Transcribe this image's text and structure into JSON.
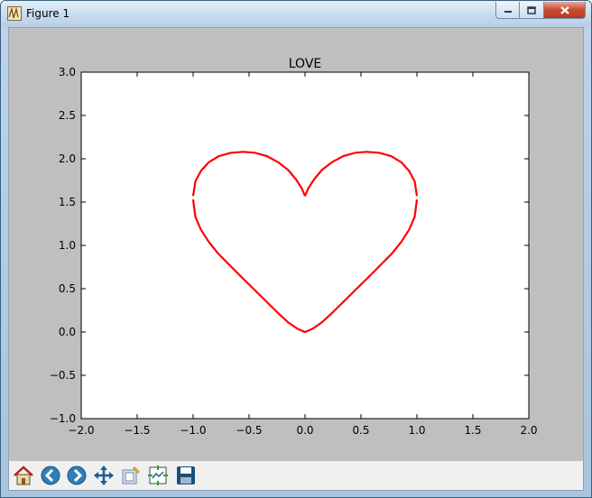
{
  "window": {
    "title": "Figure 1"
  },
  "toolbar": {
    "buttons": [
      {
        "name": "home-button",
        "icon": "home-icon"
      },
      {
        "name": "back-button",
        "icon": "back-arrow-icon"
      },
      {
        "name": "forward-button",
        "icon": "forward-arrow-icon"
      },
      {
        "name": "pan-button",
        "icon": "move-icon"
      },
      {
        "name": "zoom-button",
        "icon": "zoom-rect-icon"
      },
      {
        "name": "subplots-button",
        "icon": "subplots-icon"
      },
      {
        "name": "save-button",
        "icon": "floppy-disk-icon"
      }
    ]
  },
  "colors": {
    "curve": "#ff0000",
    "figure_background": "#bfbfbf",
    "axes_background": "#ffffff"
  },
  "chart_data": {
    "type": "line",
    "title": "LOVE",
    "xlabel": "",
    "ylabel": "",
    "xlim": [
      -2.0,
      2.0
    ],
    "ylim": [
      -1.0,
      3.0
    ],
    "xticks": [
      "−2.0",
      "−1.5",
      "−1.0",
      "−0.5",
      "0.0",
      "0.5",
      "1.0",
      "1.5",
      "2.0"
    ],
    "yticks": [
      "−1.0",
      "−0.5",
      "0.0",
      "0.5",
      "1.0",
      "1.5",
      "2.0",
      "2.5",
      "3.0"
    ],
    "grid": false,
    "series": [
      {
        "color": "#ff0000",
        "segments": [
          {
            "x": [
              -1.0,
              -0.98,
              -0.93,
              -0.86,
              -0.77,
              -0.66,
              -0.55,
              -0.45,
              -0.34,
              -0.24,
              -0.15,
              -0.08,
              -0.03,
              0.0
            ],
            "y": [
              1.57,
              1.74,
              1.86,
              1.96,
              2.03,
              2.07,
              2.08,
              2.07,
              2.03,
              1.96,
              1.87,
              1.76,
              1.66,
              1.57
            ]
          },
          {
            "x": [
              0.0,
              0.03,
              0.08,
              0.15,
              0.24,
              0.34,
              0.45,
              0.55,
              0.66,
              0.77,
              0.86,
              0.93,
              0.98,
              1.0
            ],
            "y": [
              1.57,
              1.66,
              1.76,
              1.87,
              1.96,
              2.03,
              2.07,
              2.08,
              2.07,
              2.03,
              1.96,
              1.86,
              1.74,
              1.57
            ]
          },
          {
            "x": [
              -1.0,
              -0.98,
              -0.93,
              -0.86,
              -0.78,
              -0.68,
              -0.58,
              -0.47,
              -0.36,
              -0.25,
              -0.15,
              -0.07,
              -0.02,
              0.0,
              0.02,
              0.07,
              0.15,
              0.25,
              0.36,
              0.47,
              0.58,
              0.68,
              0.78,
              0.86,
              0.93,
              0.98,
              1.0
            ],
            "y": [
              1.53,
              1.33,
              1.18,
              1.04,
              0.91,
              0.78,
              0.65,
              0.51,
              0.37,
              0.23,
              0.11,
              0.04,
              0.01,
              0.0,
              0.01,
              0.04,
              0.11,
              0.23,
              0.37,
              0.51,
              0.65,
              0.78,
              0.91,
              1.04,
              1.18,
              1.33,
              1.53
            ]
          }
        ]
      }
    ]
  }
}
